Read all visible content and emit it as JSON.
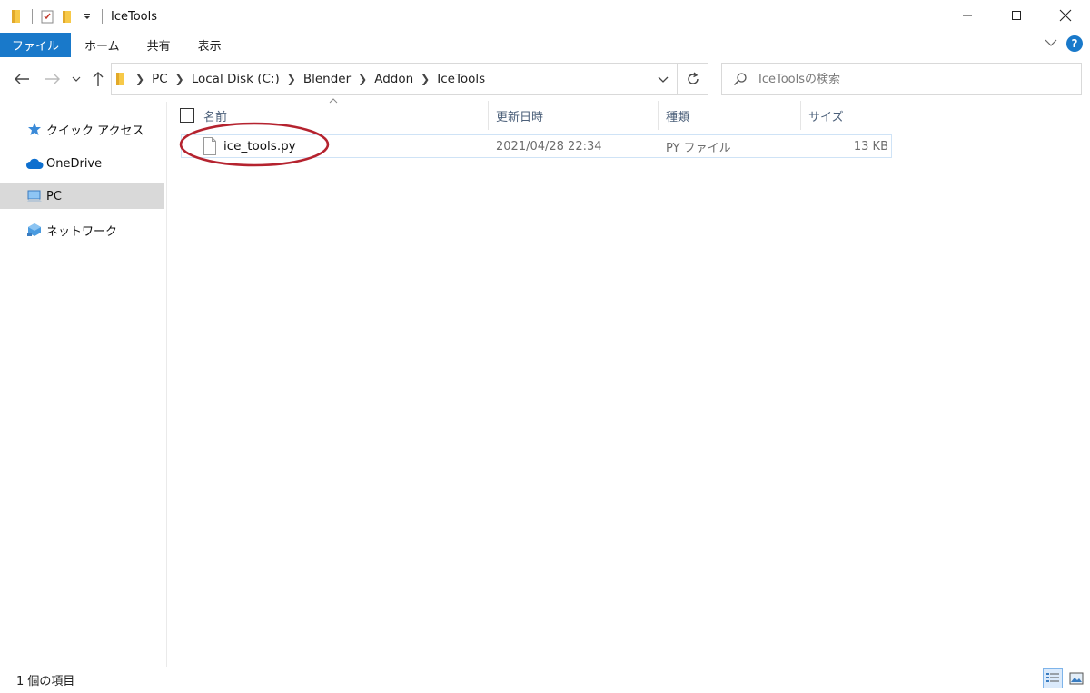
{
  "window": {
    "title": "IceTools"
  },
  "ribbon": {
    "tabs": [
      "ファイル",
      "ホーム",
      "共有",
      "表示"
    ],
    "help_label": "?"
  },
  "address": {
    "crumbs": [
      "PC",
      "Local Disk (C:)",
      "Blender",
      "Addon",
      "IceTools"
    ]
  },
  "search": {
    "placeholder": "IceToolsの検索"
  },
  "sidebar": {
    "items": [
      {
        "label": "クイック アクセス",
        "icon": "star-icon"
      },
      {
        "label": "OneDrive",
        "icon": "cloud-icon"
      },
      {
        "label": "PC",
        "icon": "computer-icon",
        "selected": true
      },
      {
        "label": "ネットワーク",
        "icon": "network-icon"
      }
    ]
  },
  "columns": {
    "name": "名前",
    "date": "更新日時",
    "type": "種類",
    "size": "サイズ"
  },
  "files": [
    {
      "name": "ice_tools.py",
      "date": "2021/04/28 22:34",
      "type": "PY ファイル",
      "size": "13 KB"
    }
  ],
  "status": {
    "text": "1 個の項目"
  },
  "colors": {
    "accent": "#1979ca",
    "annotation": "#b5232f",
    "selection": "#d9d9d9"
  }
}
